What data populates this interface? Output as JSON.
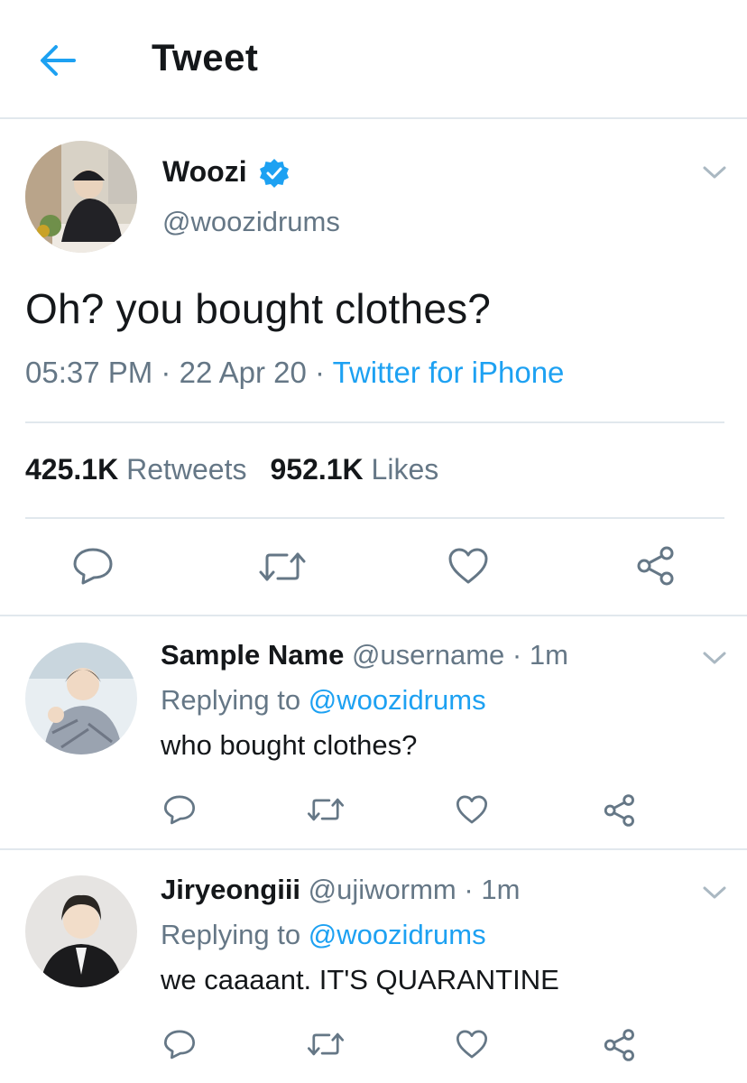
{
  "header": {
    "title": "Tweet"
  },
  "tweet": {
    "name": "Woozi",
    "handle": "@woozidrums",
    "text": "Oh? you bought clothes?",
    "time": "05:37 PM",
    "date": "22 Apr 20",
    "separator": "·",
    "source": "Twitter for iPhone",
    "retweets_count": "425.1K",
    "retweets_label": "Retweets",
    "likes_count": "952.1K",
    "likes_label": "Likes"
  },
  "replies": [
    {
      "name": "Sample Name",
      "handle": "@username",
      "time": "1m",
      "replying_label": "Replying to",
      "replying_to": "@woozidrums",
      "text": "who bought clothes?"
    },
    {
      "name": "Jiryeongiii",
      "handle": "@ujiwormm",
      "time": "1m",
      "replying_label": "Replying to",
      "replying_to": "@woozidrums",
      "text": "we caaaant. IT'S QUARANTINE"
    }
  ],
  "icons": {
    "back": "arrow-left-icon",
    "verified": "verified-badge-icon",
    "more": "chevron-down-icon",
    "reply": "reply-icon",
    "retweet": "retweet-icon",
    "like": "heart-icon",
    "share": "share-icon"
  },
  "colors": {
    "accent": "#1da1f2",
    "text": "#14171a",
    "secondary": "#657786",
    "divider": "#e1e8ed"
  }
}
